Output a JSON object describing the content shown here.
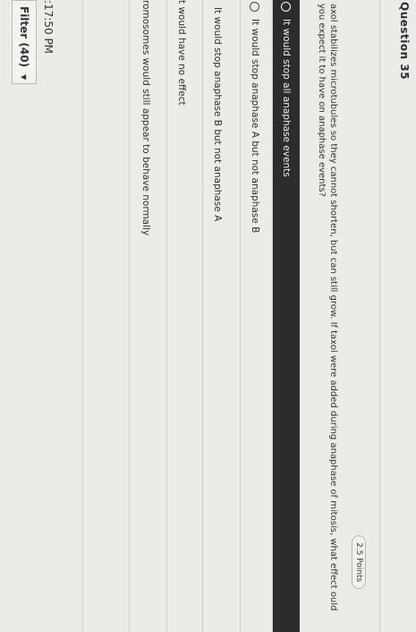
{
  "question": {
    "title": "Question 35",
    "points": "2.5 Points",
    "text": "axol stabilizes microtubules so they cannot shorten, but can still grow. If taxol were added during anaphase of mitosis, what effect ould you expect it to have on anaphase events?"
  },
  "options": [
    {
      "label": "It would stop all anaphase events",
      "selected": true
    },
    {
      "label": "It would stop anaphase A but not anaphase B",
      "selected": false
    },
    {
      "label": "It would stop anaphase B but not anaphase A",
      "selected": false
    },
    {
      "label": "t would have no effect",
      "selected": false
    },
    {
      "label": "romosomes would still appear to behave normally",
      "selected": false
    }
  ],
  "footer": {
    "time": ":17:50 PM",
    "filter_label": "Filter (40)",
    "filter_caret": "▼"
  }
}
